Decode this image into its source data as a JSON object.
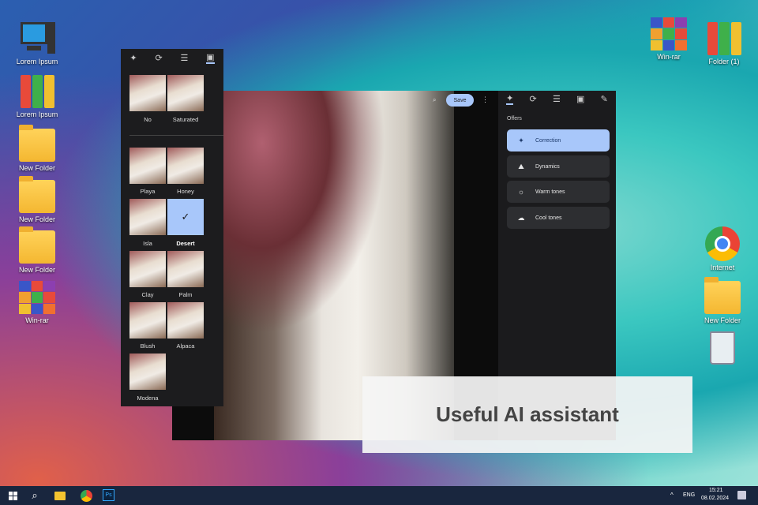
{
  "desktop": {
    "left_icons": [
      "Lorem Ipsum",
      "Lorem Ipsum",
      "New Folder",
      "New Folder",
      "New Folder",
      "Win-rar"
    ],
    "right_top_icons": [
      "Win-rar",
      "Folder (1)"
    ],
    "right_icons": [
      "Internet",
      "New Folder"
    ]
  },
  "filters": {
    "rows": [
      [
        "No",
        "Saturated"
      ],
      [
        "Playa",
        "Honey"
      ],
      [
        "Isla",
        "Desert"
      ],
      [
        "Clay",
        "Palm"
      ],
      [
        "Blush",
        "Alpaca"
      ],
      [
        "Modena"
      ]
    ],
    "selected": "Desert"
  },
  "editor": {
    "save_label": "Save",
    "offers_title": "Offers",
    "offers": [
      "Correction",
      "Dynamics",
      "Warm tones",
      "Cool tones"
    ],
    "selected_offer": "Correction"
  },
  "caption": "Useful AI assistant",
  "taskbar": {
    "lang": "ENG",
    "time": "15:21",
    "date": "08.02.2024",
    "ps_label": "Ps"
  },
  "colors": {
    "accent": "#a8c7fa",
    "taskbar": "#19263e"
  }
}
